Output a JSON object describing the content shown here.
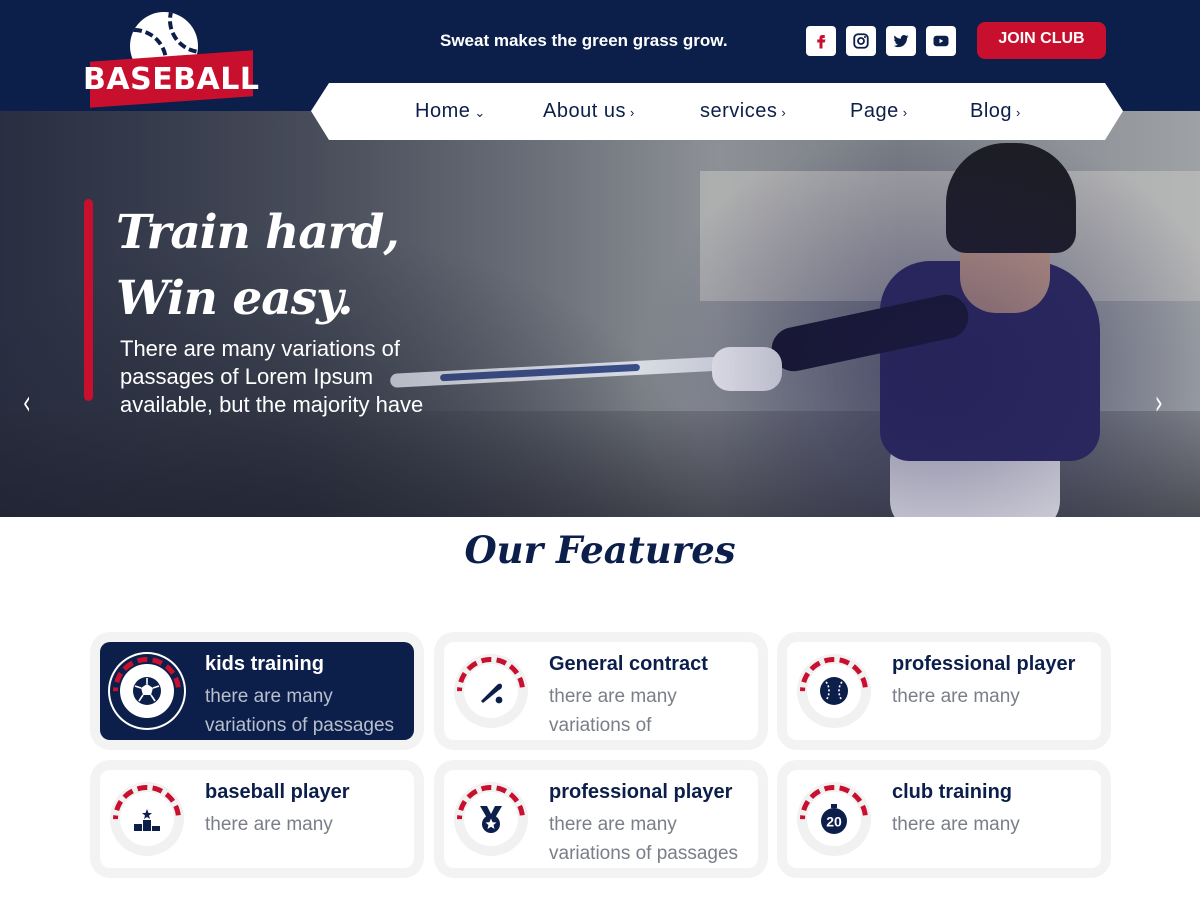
{
  "brand": {
    "logo_text": "BASEBALL"
  },
  "header": {
    "tagline": "Sweat makes the green grass grow.",
    "social": [
      "facebook-icon",
      "instagram-icon",
      "twitter-icon",
      "youtube-icon"
    ],
    "join_label": "JOIN CLUB"
  },
  "nav": {
    "items": [
      {
        "label": "Home",
        "chevron": "⌄"
      },
      {
        "label": "About us",
        "chevron": "›"
      },
      {
        "label": "services",
        "chevron": "›"
      },
      {
        "label": "Page",
        "chevron": "›"
      },
      {
        "label": "Blog",
        "chevron": "›"
      }
    ]
  },
  "hero": {
    "title_line1": "Train hard,",
    "title_line2": "Win easy.",
    "text": "There are many variations of passages of Lorem Ipsum available, but the majority have",
    "prev_arrow": "‹",
    "next_arrow": "›"
  },
  "features": {
    "title": "Our Features",
    "cards": [
      {
        "title": "kids training",
        "desc": "there are many variations of passages",
        "icon": "soccer-ball-icon",
        "active": true
      },
      {
        "title": "General contract",
        "desc": "there are many variations of",
        "icon": "baseball-bat-icon",
        "active": false
      },
      {
        "title": "professional player",
        "desc": "there are many",
        "icon": "baseball-icon",
        "active": false
      },
      {
        "title": "baseball player",
        "desc": "there are many",
        "icon": "podium-icon",
        "active": false
      },
      {
        "title": "professional player",
        "desc": "there are many variations of passages",
        "icon": "medal-icon",
        "active": false
      },
      {
        "title": "club training",
        "desc": "there are many",
        "icon": "stopwatch-20-icon",
        "active": false
      }
    ],
    "stopwatch_number": "20"
  },
  "colors": {
    "navy": "#0c1f4b",
    "red": "#c8102e"
  }
}
